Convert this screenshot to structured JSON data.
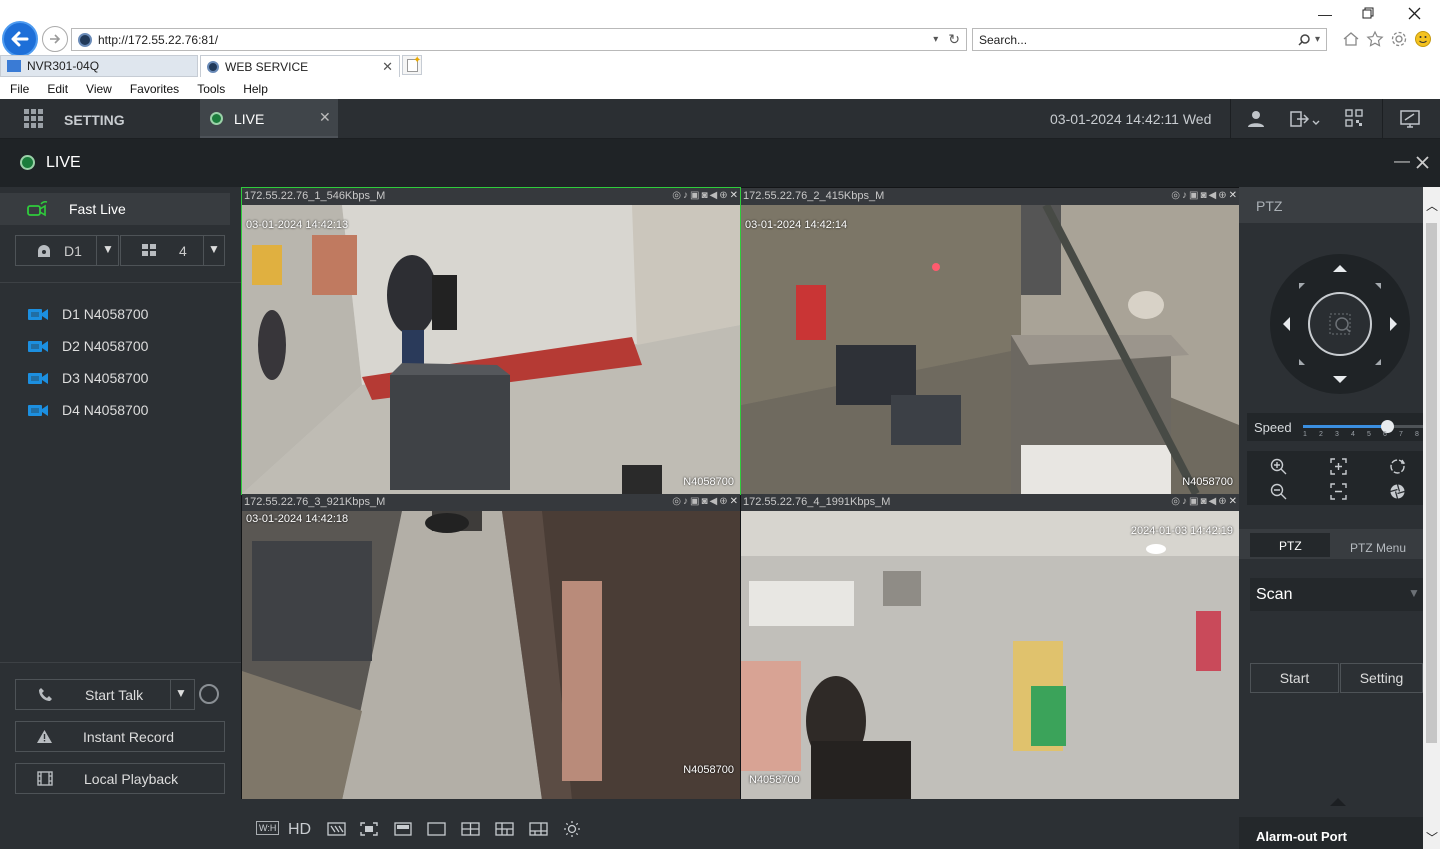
{
  "browser": {
    "url": "http://172.55.22.76:81/",
    "search_placeholder": "Search...",
    "tabs": [
      {
        "label": "NVR301-04Q"
      },
      {
        "label": "WEB SERVICE"
      }
    ],
    "menu": [
      "File",
      "Edit",
      "View",
      "Favorites",
      "Tools",
      "Help"
    ]
  },
  "app": {
    "nav_setting": "SETTING",
    "nav_live": "LIVE",
    "datetime": "03-01-2024 14:42:11 Wed",
    "page_title": "LIVE"
  },
  "left": {
    "fast_live": "Fast Live",
    "device_select": "D1",
    "layout_select": "4",
    "channels": [
      {
        "label": "D1 N4058700"
      },
      {
        "label": "D2 N4058700"
      },
      {
        "label": "D3 N4058700"
      },
      {
        "label": "D4 N4058700"
      }
    ],
    "start_talk": "Start Talk",
    "instant_record": "Instant Record",
    "local_playback": "Local Playback"
  },
  "video": {
    "cells": [
      {
        "header": "172.55.22.76_1_546Kbps_M",
        "timestamp": "03-01-2024 14:42:13",
        "camera_id": "N4058700"
      },
      {
        "header": "172.55.22.76_2_415Kbps_M",
        "timestamp": "03-01-2024 14:42:14",
        "camera_id": "N4058700"
      },
      {
        "header": "172.55.22.76_3_921Kbps_M",
        "timestamp": "03-01-2024 14:42:18",
        "camera_id": "N4058700"
      },
      {
        "header": "172.55.22.76_4_1991Kbps_M",
        "timestamp": "2024-01-03 14:42:19",
        "camera_id": "N4058700"
      }
    ],
    "bottom_hd": "HD",
    "bottom_wh": "W:H"
  },
  "right": {
    "ptz_title": "PTZ",
    "speed_label": "Speed",
    "speed_value": 6,
    "speed_ticks": [
      "1",
      "2",
      "3",
      "4",
      "5",
      "6",
      "7",
      "8"
    ],
    "tab_ptz": "PTZ",
    "tab_ptz_menu": "PTZ Menu",
    "mode_select": "Scan",
    "start_btn": "Start",
    "setting_btn": "Setting",
    "alarm_out": "Alarm-out Port"
  },
  "colors": {
    "accent_green": "#2fcc3c",
    "channel_blue": "#1c8fe0",
    "bg_dark": "#2c3034"
  }
}
